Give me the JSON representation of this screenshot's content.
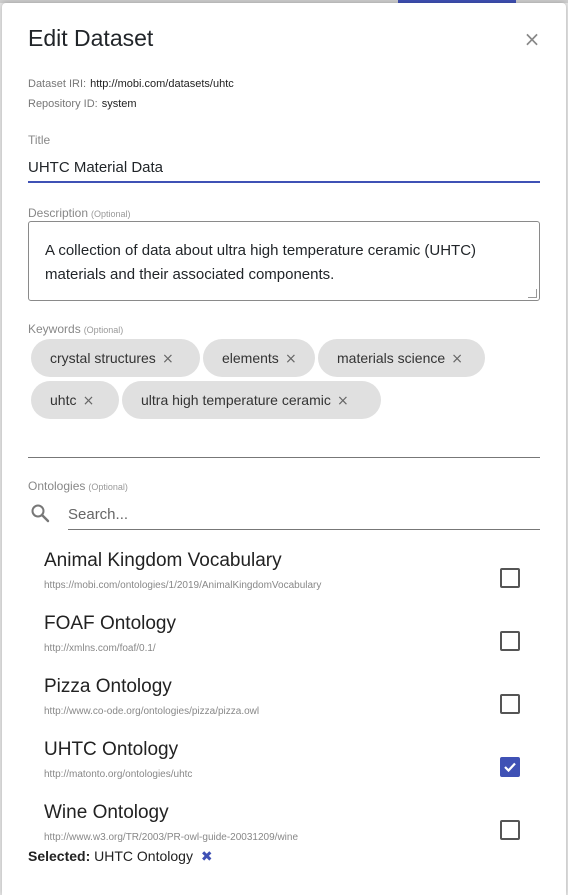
{
  "modal": {
    "title": "Edit Dataset",
    "close_icon": "×"
  },
  "meta": {
    "iri_label": "Dataset IRI:",
    "iri_value": "http://mobi.com/datasets/uhtc",
    "repo_label": "Repository ID:",
    "repo_value": "system"
  },
  "fields": {
    "title_label": "Title",
    "title_value": "UHTC Material Data",
    "description_label": "Description",
    "description_optional": "(Optional)",
    "description_value": "A collection of data about ultra high temperature ceramic (UHTC) materials and their associated components.",
    "keywords_label": "Keywords",
    "keywords_optional": "(Optional)",
    "ontologies_label": "Ontologies",
    "ontologies_optional": "(Optional)"
  },
  "keywords": [
    {
      "label": "crystal structures",
      "remove": "×"
    },
    {
      "label": "elements",
      "remove": "×"
    },
    {
      "label": "materials science",
      "remove": "×"
    },
    {
      "label": "uhtc",
      "remove": "×"
    },
    {
      "label": "ultra high temperature ceramic",
      "remove": "×"
    }
  ],
  "search": {
    "placeholder": "Search...",
    "icon": "search-icon"
  },
  "ontologies": [
    {
      "name": "Animal Kingdom Vocabulary",
      "iri": "https://mobi.com/ontologies/1/2019/AnimalKingdomVocabulary",
      "checked": false
    },
    {
      "name": "FOAF Ontology",
      "iri": "http://xmlns.com/foaf/0.1/",
      "checked": false
    },
    {
      "name": "Pizza Ontology",
      "iri": "http://www.co-ode.org/ontologies/pizza/pizza.owl",
      "checked": false
    },
    {
      "name": "UHTC Ontology",
      "iri": "http://matonto.org/ontologies/uhtc",
      "checked": true
    },
    {
      "name": "Wine Ontology",
      "iri": "http://www.w3.org/TR/2003/PR-owl-guide-20031209/wine",
      "checked": false
    }
  ],
  "selected": {
    "label": "Selected:",
    "value": "UHTC Ontology",
    "remove_icon": "✖"
  },
  "colors": {
    "accent": "#3f51b5"
  }
}
